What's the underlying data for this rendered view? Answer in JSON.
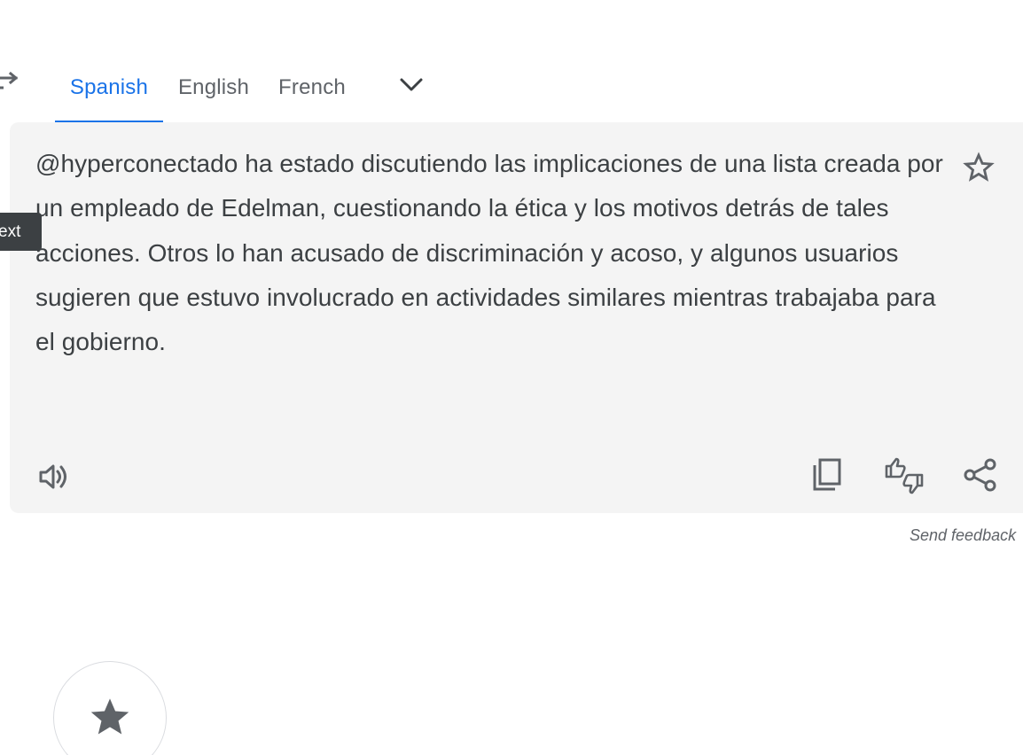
{
  "language_tabs": [
    {
      "label": "Spanish",
      "active": true
    },
    {
      "label": "English",
      "active": false
    },
    {
      "label": "French",
      "active": false
    }
  ],
  "tooltip": {
    "text": "ext"
  },
  "translation": {
    "text": "@hyperconectado ha estado discutiendo las implicaciones de una lista creada por un empleado de Edelman, cuestionando la ética y los motivos detrás de tales acciones. Otros lo han acusado de discriminación y acoso, y algunos usuarios sugieren que estuvo involucrado en actividades similares mientras trabajaba para el gobierno."
  },
  "feedback": {
    "label": "Send feedback"
  },
  "icons": {
    "swap": "swap-languages-icon",
    "more_languages": "chevron-down-icon",
    "save": "star-outline-icon",
    "listen": "speaker-icon",
    "copy": "copy-icon",
    "rate": "thumbs-up-down-icon",
    "share": "share-icon",
    "saved": "star-filled-icon"
  },
  "colors": {
    "accent": "#1a73e8",
    "text": "#3c4043",
    "muted": "#5f6368",
    "card_background": "#f4f4f4",
    "tooltip_background": "#3c4043"
  }
}
